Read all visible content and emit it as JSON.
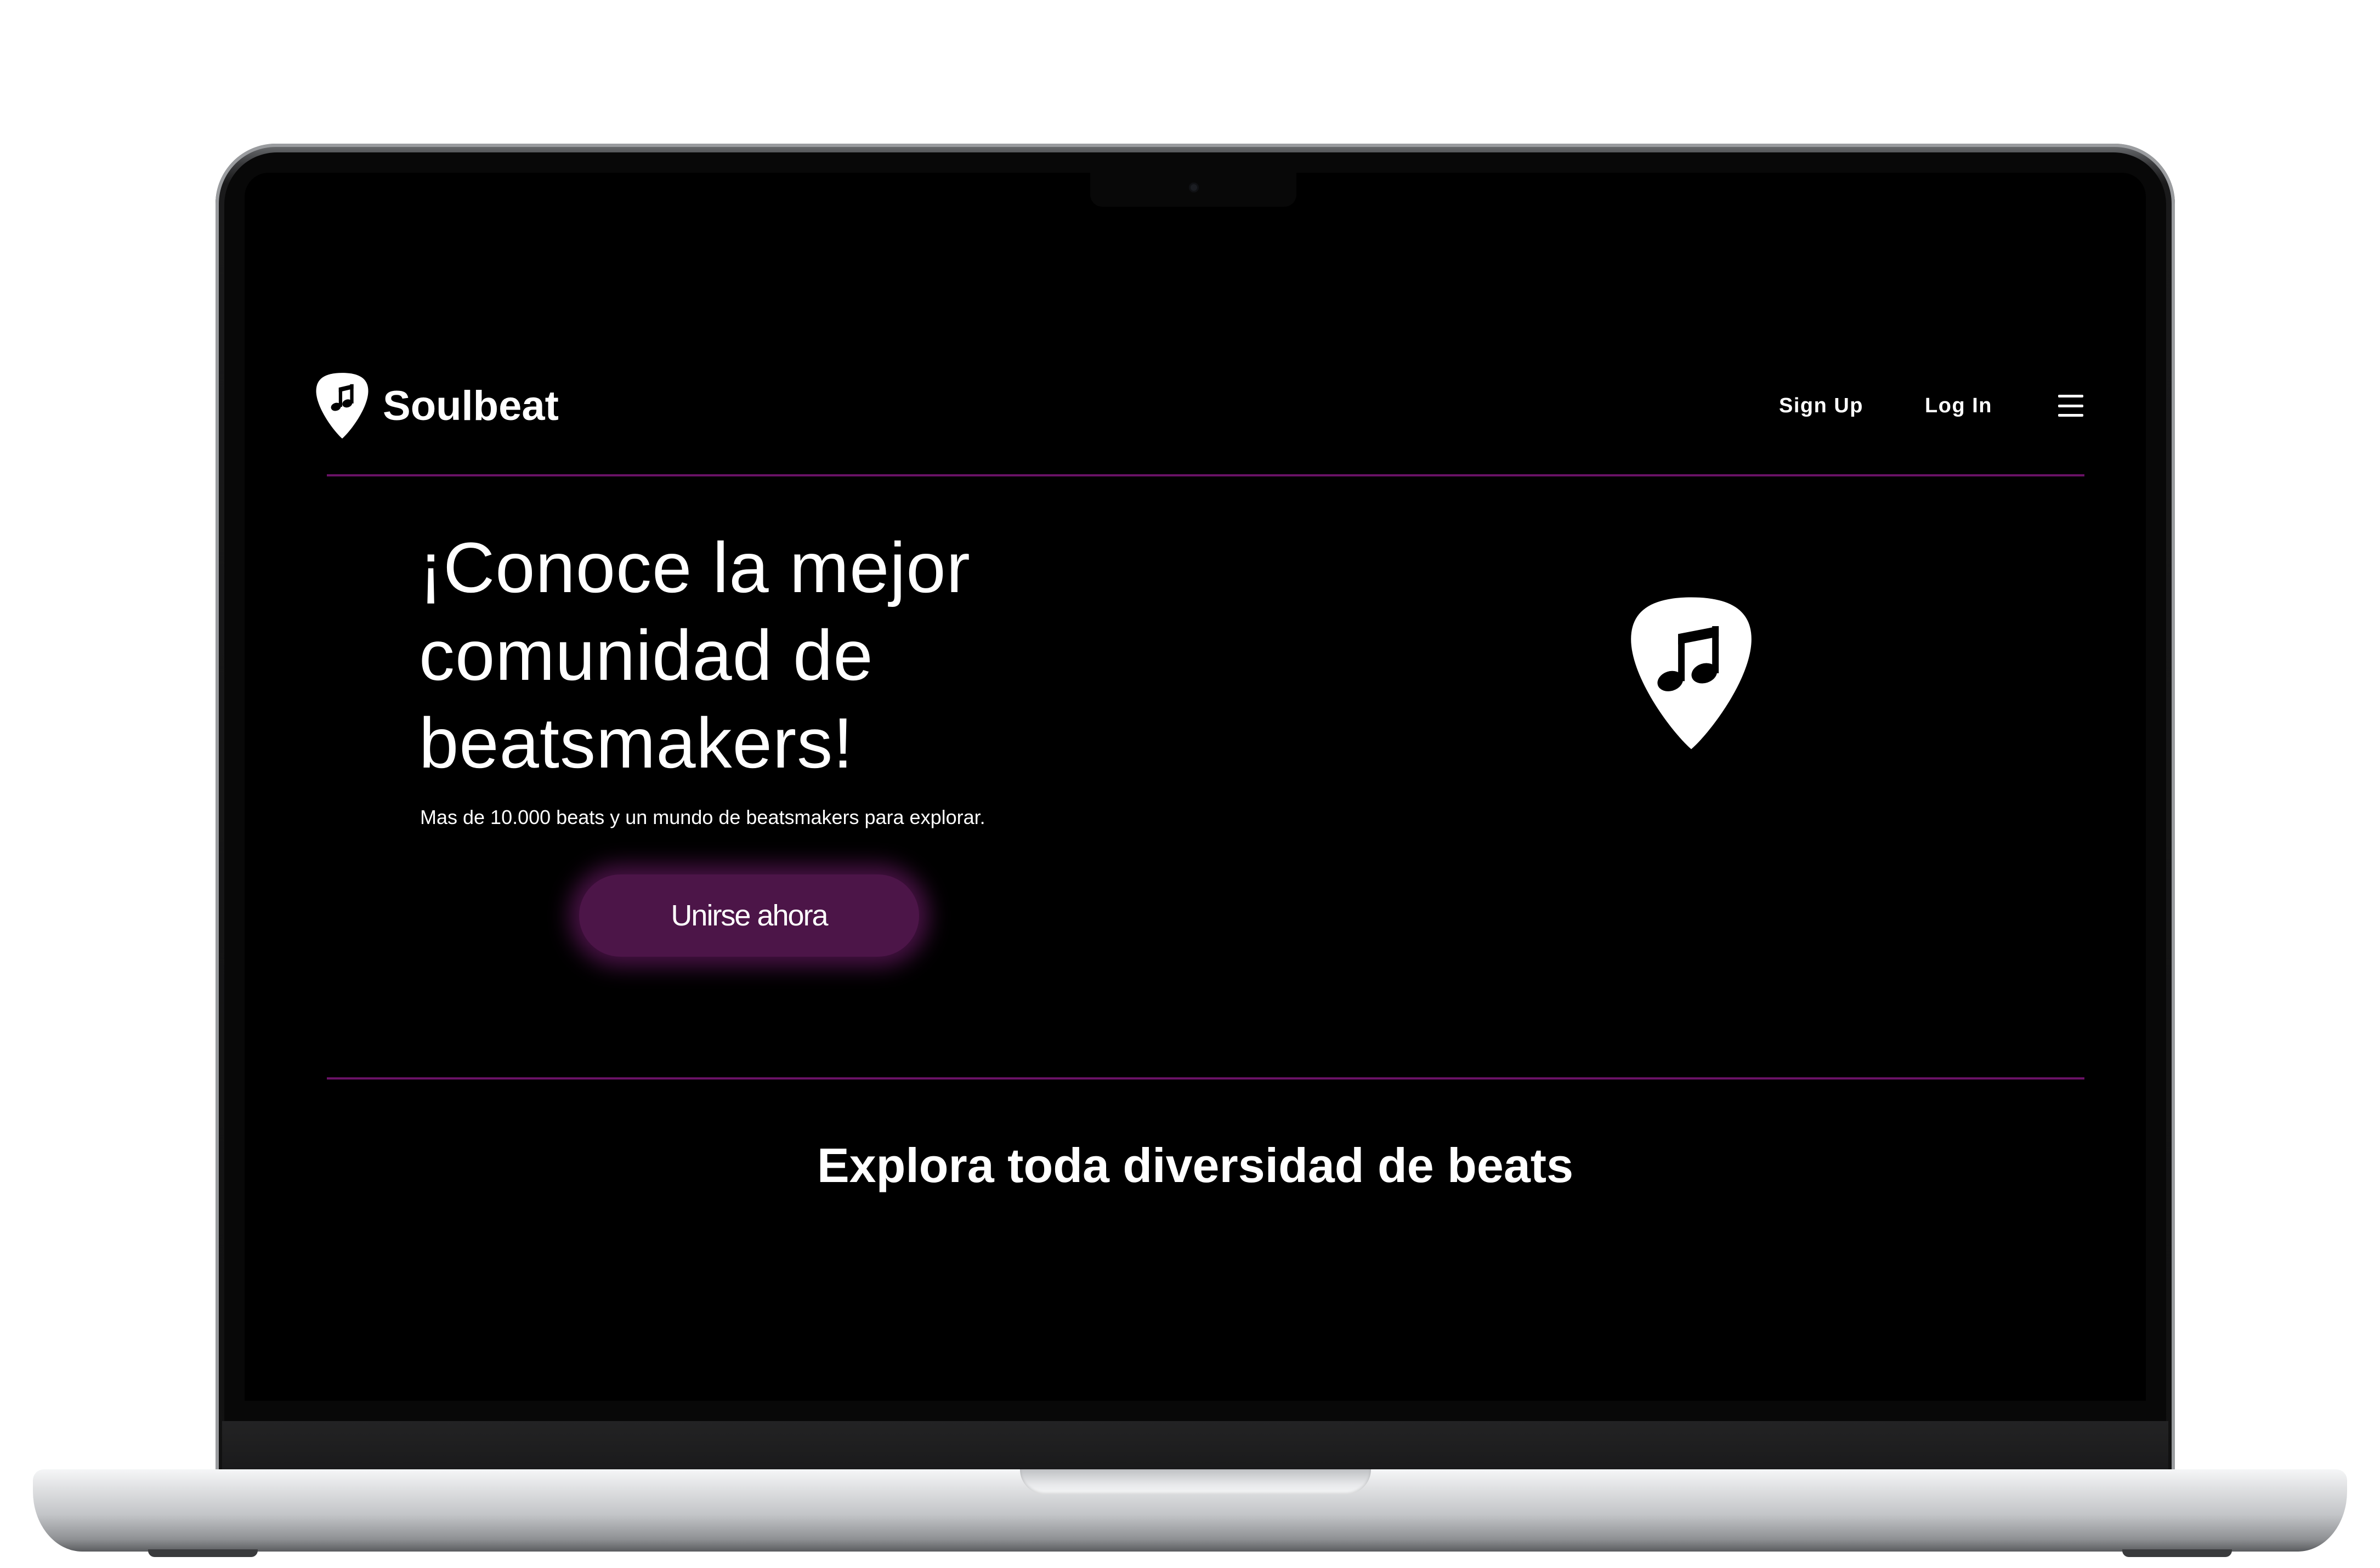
{
  "header": {
    "brand_name": "Soulbeat",
    "logo_icon": "guitar-pick-music-note-icon",
    "nav": {
      "sign_up": "Sign Up",
      "log_in": "Log In",
      "menu_icon": "hamburger-menu-icon"
    }
  },
  "hero": {
    "title_lines": [
      "¡Conoce la mejor",
      "comunidad de",
      "beatsmakers!"
    ],
    "subtitle": "Mas de 10.000 beats y un mundo de beatsmakers para explorar.",
    "cta_label": "Unirse ahora",
    "illustration_icon": "guitar-pick-music-note-icon"
  },
  "section": {
    "title": "Explora toda diversidad de beats"
  },
  "colors": {
    "background": "#000000",
    "text": "#ffffff",
    "divider": "#6a1266",
    "cta_background": "#4c1548",
    "cta_glow": "#60185c"
  }
}
